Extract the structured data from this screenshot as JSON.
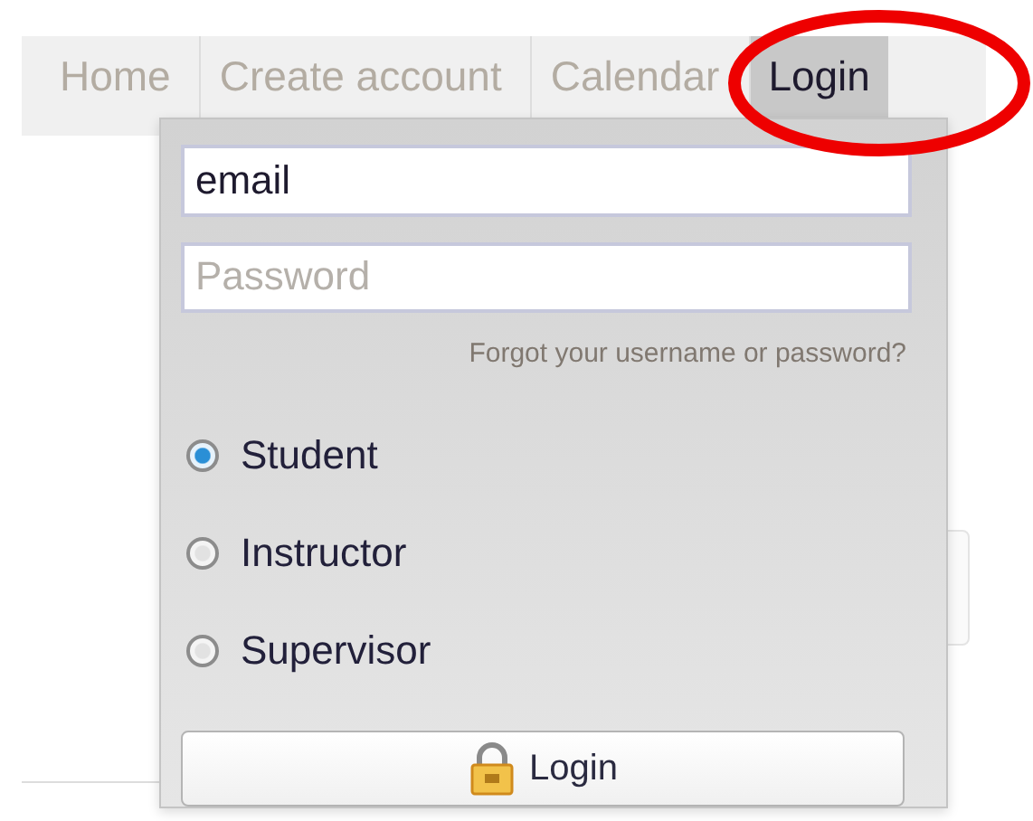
{
  "nav": {
    "items": [
      {
        "label": "Home",
        "selected": false
      },
      {
        "label": "Create account",
        "selected": false
      },
      {
        "label": "Calendar",
        "selected": false
      },
      {
        "label": "Login",
        "selected": true
      }
    ]
  },
  "login_dropdown": {
    "email": {
      "value": "email"
    },
    "password": {
      "placeholder": "Password"
    },
    "forgot_link": "Forgot your username or password?",
    "roles": [
      {
        "label": "Student",
        "selected": true
      },
      {
        "label": "Instructor",
        "selected": false
      },
      {
        "label": "Supervisor",
        "selected": false
      }
    ],
    "submit": "Login"
  }
}
